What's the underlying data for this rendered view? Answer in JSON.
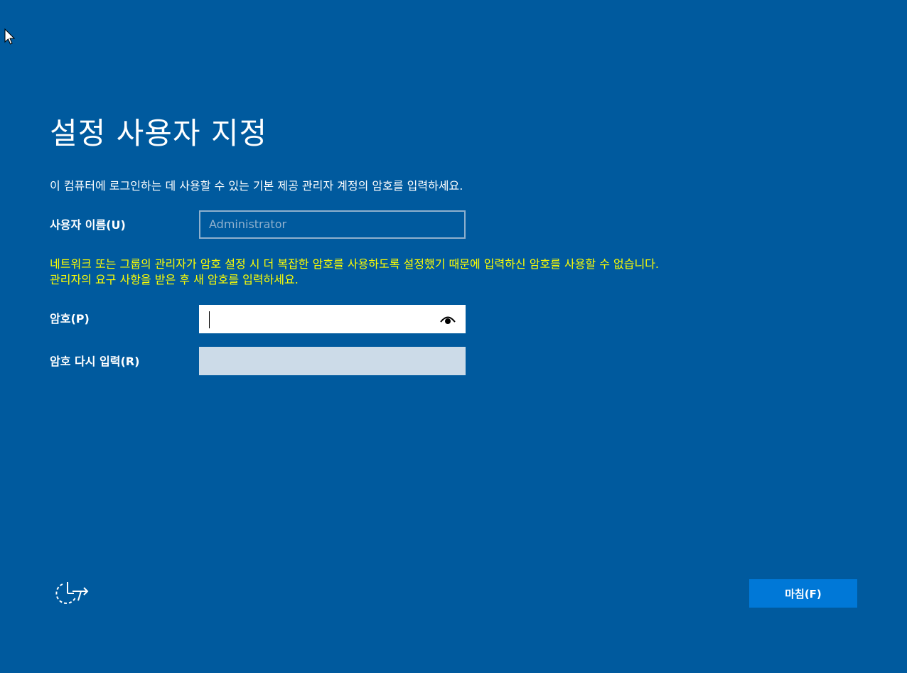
{
  "page": {
    "title": "설정 사용자 지정",
    "instruction": "이 컴퓨터에 로그인하는 데 사용할 수 있는 기본 제공 관리자 계정의 암호를 입력하세요."
  },
  "username": {
    "label": "사용자 이름(U)",
    "value": "Administrator"
  },
  "warning": {
    "line1": "네트워크 또는 그룹의 관리자가 암호 설정 시 더 복잡한 암호를 사용하도록 설정했기 때문에 입력하신 암호를 사용할 수 없습니다.",
    "line2": "관리자의 요구 사항을 받은 후 새 암호를 입력하세요."
  },
  "password": {
    "label": "암호(P)",
    "value": "",
    "reveal_icon": "eye-icon"
  },
  "confirm_password": {
    "label": "암호 다시 입력(R)",
    "value": ""
  },
  "accessibility": {
    "icon": "ease-of-access-icon"
  },
  "finish": {
    "label": "마침(F)"
  },
  "colors": {
    "background": "#005a9e",
    "warning_text": "#ffff00",
    "button": "#0078d7",
    "disabled_field": "#ccdbe8"
  }
}
